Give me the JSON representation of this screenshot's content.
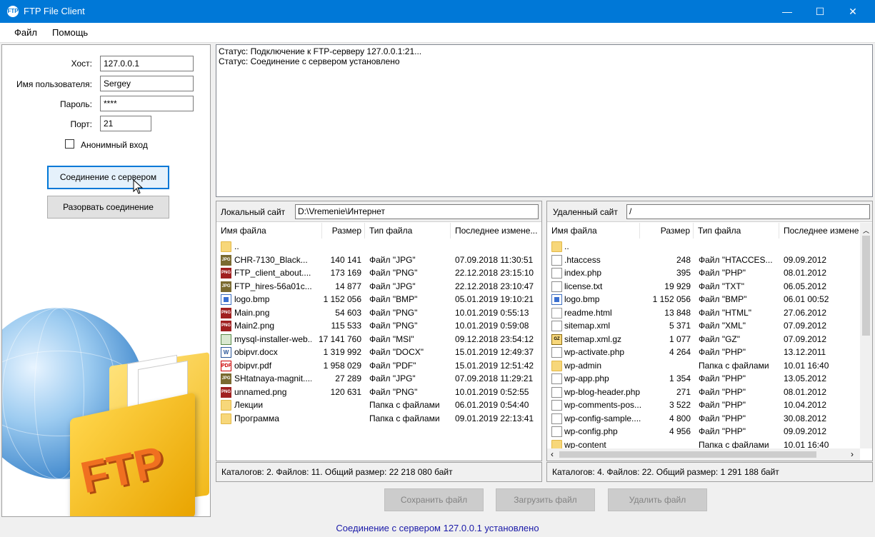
{
  "window": {
    "title": "FTP File Client",
    "icon": "ftp-app-icon",
    "minimize": "—",
    "maximize": "☐",
    "close": "✕"
  },
  "menu": {
    "file": "Файл",
    "help": "Помощь"
  },
  "connection": {
    "host_label": "Хост:",
    "host_value": "127.0.0.1",
    "user_label": "Имя пользователя:",
    "user_value": "Sergey",
    "password_label": "Пароль:",
    "password_value": "****",
    "port_label": "Порт:",
    "port_value": "21",
    "anon_label": "Анонимный вход",
    "connect_button": "Соединение с сервером",
    "disconnect_button": "Разорвать соединение",
    "logo_text": "FTP"
  },
  "log": {
    "lines": [
      "Статус:  Подключение к FTP-серверу 127.0.0.1:21...",
      "Статус:  Соединение с сервером установлено"
    ]
  },
  "local": {
    "label": "Локальный сайт",
    "path": "D:\\Vremenie\\Интернет",
    "columns": [
      "Имя файла",
      "Размер",
      "Тип файла",
      "Последнее измене..."
    ],
    "rows": [
      {
        "icon": "folder",
        "name": "..",
        "size": "",
        "type": "",
        "date": ""
      },
      {
        "icon": "jpg",
        "name": "CHR-7130_Black...",
        "size": "140 141",
        "type": "Файл \"JPG\"",
        "date": "07.09.2018 11:30:51"
      },
      {
        "icon": "png",
        "name": "FTP_client_about....",
        "size": "173 169",
        "type": "Файл \"PNG\"",
        "date": "22.12.2018 23:15:10"
      },
      {
        "icon": "jpg",
        "name": "FTP_hires-56a01c...",
        "size": "14 877",
        "type": "Файл \"JPG\"",
        "date": "22.12.2018 23:10:47"
      },
      {
        "icon": "bmp",
        "name": "logo.bmp",
        "size": "1 152 056",
        "type": "Файл \"BMP\"",
        "date": "05.01.2019 19:10:21"
      },
      {
        "icon": "png",
        "name": "Main.png",
        "size": "54 603",
        "type": "Файл \"PNG\"",
        "date": "10.01.2019 0:55:13"
      },
      {
        "icon": "png",
        "name": "Main2.png",
        "size": "115 533",
        "type": "Файл \"PNG\"",
        "date": "10.01.2019 0:59:08"
      },
      {
        "icon": "msi",
        "name": "mysql-installer-web...",
        "size": "17 141 760",
        "type": "Файл \"MSI\"",
        "date": "09.12.2018 23:54:12"
      },
      {
        "icon": "docx",
        "name": "obipvr.docx",
        "size": "1 319 992",
        "type": "Файл \"DOCX\"",
        "date": "15.01.2019 12:49:37"
      },
      {
        "icon": "pdf",
        "name": "obipvr.pdf",
        "size": "1 958 029",
        "type": "Файл \"PDF\"",
        "date": "15.01.2019 12:51:42"
      },
      {
        "icon": "jpg",
        "name": "SHtatnaya-magnit....",
        "size": "27 289",
        "type": "Файл \"JPG\"",
        "date": "07.09.2018 11:29:21"
      },
      {
        "icon": "png",
        "name": "unnamed.png",
        "size": "120 631",
        "type": "Файл \"PNG\"",
        "date": "10.01.2019 0:52:55"
      },
      {
        "icon": "folder",
        "name": "Лекции",
        "size": "",
        "type": "Папка с файлами",
        "date": "06.01.2019 0:54:40"
      },
      {
        "icon": "folder",
        "name": "Программа",
        "size": "",
        "type": "Папка с файлами",
        "date": "09.01.2019 22:13:41"
      }
    ],
    "summary": "Каталогов: 2. Файлов: 11. Общий размер: 22 218 080 байт"
  },
  "remote": {
    "label": "Удаленный сайт",
    "path": "/",
    "columns": [
      "Имя файла",
      "Размер",
      "Тип файла",
      "Последнее измене"
    ],
    "rows": [
      {
        "icon": "folder",
        "name": "..",
        "size": "",
        "type": "",
        "date": ""
      },
      {
        "icon": "doc",
        "name": ".htaccess",
        "size": "248",
        "type": "Файл \"HTACCES...",
        "date": "09.09.2012"
      },
      {
        "icon": "doc",
        "name": "index.php",
        "size": "395",
        "type": "Файл \"PHP\"",
        "date": "08.01.2012"
      },
      {
        "icon": "doc",
        "name": "license.txt",
        "size": "19 929",
        "type": "Файл \"TXT\"",
        "date": "06.05.2012"
      },
      {
        "icon": "bmp",
        "name": "logo.bmp",
        "size": "1 152 056",
        "type": "Файл \"BMP\"",
        "date": "06.01 00:52"
      },
      {
        "icon": "html",
        "name": "readme.html",
        "size": "13 848",
        "type": "Файл \"HTML\"",
        "date": "27.06.2012"
      },
      {
        "icon": "doc",
        "name": "sitemap.xml",
        "size": "5 371",
        "type": "Файл \"XML\"",
        "date": "07.09.2012"
      },
      {
        "icon": "gz",
        "name": "sitemap.xml.gz",
        "size": "1 077",
        "type": "Файл \"GZ\"",
        "date": "07.09.2012"
      },
      {
        "icon": "doc",
        "name": "wp-activate.php",
        "size": "4 264",
        "type": "Файл \"PHP\"",
        "date": "13.12.2011"
      },
      {
        "icon": "folder",
        "name": "wp-admin",
        "size": "",
        "type": "Папка с файлами",
        "date": "10.01 16:40"
      },
      {
        "icon": "doc",
        "name": "wp-app.php",
        "size": "1 354",
        "type": "Файл \"PHP\"",
        "date": "13.05.2012"
      },
      {
        "icon": "doc",
        "name": "wp-blog-header.php",
        "size": "271",
        "type": "Файл \"PHP\"",
        "date": "08.01.2012"
      },
      {
        "icon": "doc",
        "name": "wp-comments-pos...",
        "size": "3 522",
        "type": "Файл \"PHP\"",
        "date": "10.04.2012"
      },
      {
        "icon": "doc",
        "name": "wp-config-sample....",
        "size": "4 800",
        "type": "Файл \"PHP\"",
        "date": "30.08.2012"
      },
      {
        "icon": "doc",
        "name": "wp-config.php",
        "size": "4 956",
        "type": "Файл \"PHP\"",
        "date": "09.09.2012"
      },
      {
        "icon": "folder",
        "name": "wp-content",
        "size": "",
        "type": "Папка с файлами",
        "date": "10.01 16:40"
      }
    ],
    "summary": "Каталогов: 4. Файлов: 22. Общий размер: 1 291 188 байт"
  },
  "actions": {
    "save": "Сохранить файл",
    "upload": "Загрузить файл",
    "delete": "Удалить файл"
  },
  "statusbar": "Соединение с сервером 127.0.0.1 установлено",
  "colors": {
    "titlebar": "#0078d7",
    "status_text": "#1a1aa8",
    "focus": "#0078d7"
  }
}
